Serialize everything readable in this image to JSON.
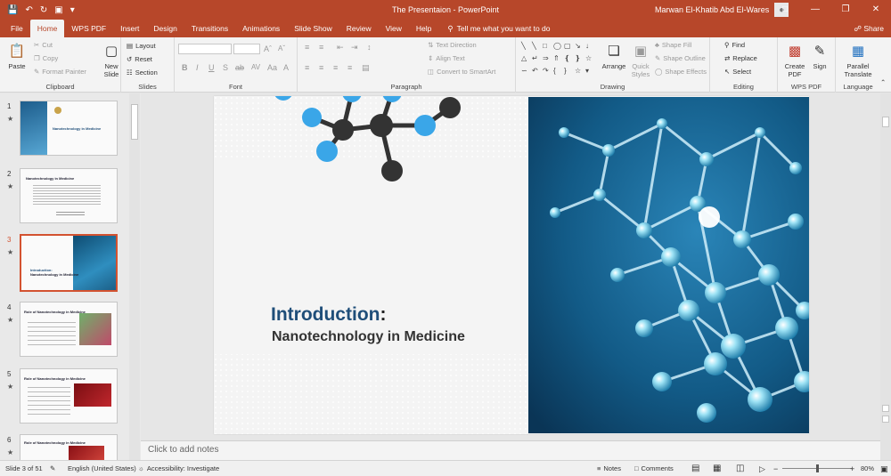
{
  "window": {
    "title": "The Presentaion  -  PowerPoint",
    "user": "Marwan El-Khatib Abd El-Wares"
  },
  "tabs": [
    {
      "label": "File"
    },
    {
      "label": "Home"
    },
    {
      "label": "WPS PDF"
    },
    {
      "label": "Insert"
    },
    {
      "label": "Design"
    },
    {
      "label": "Transitions"
    },
    {
      "label": "Animations"
    },
    {
      "label": "Slide Show"
    },
    {
      "label": "Review"
    },
    {
      "label": "View"
    },
    {
      "label": "Help"
    }
  ],
  "tellme": "Tell me what you want to do",
  "share": "Share",
  "ribbon": {
    "clipboard": {
      "label": "Clipboard",
      "paste": "Paste",
      "cut": "Cut",
      "copy": "Copy",
      "format_painter": "Format Painter"
    },
    "slides": {
      "label": "Slides",
      "new_slide": "New Slide",
      "layout": "Layout",
      "reset": "Reset",
      "section": "Section"
    },
    "font": {
      "label": "Font"
    },
    "paragraph": {
      "label": "Paragraph",
      "text_direction": "Text Direction",
      "align_text": "Align Text",
      "convert": "Convert to SmartArt"
    },
    "drawing": {
      "label": "Drawing",
      "arrange": "Arrange",
      "quick_styles": "Quick Styles",
      "shape_fill": "Shape Fill",
      "shape_outline": "Shape Outline",
      "shape_effects": "Shape Effects"
    },
    "editing": {
      "label": "Editing",
      "find": "Find",
      "replace": "Replace",
      "select": "Select"
    },
    "wps": {
      "label": "WPS PDF",
      "create_pdf": "Create PDF",
      "sign": "Sign"
    },
    "language": {
      "label": "Language",
      "parallel_translate": "Parallel Translate"
    }
  },
  "thumbnails": [
    {
      "num": "1",
      "title": "Nanotechnology in Medicine"
    },
    {
      "num": "2",
      "title": "Nanotechnology in Medicine"
    },
    {
      "num": "3",
      "title": "Introduction:",
      "sub": "Nanotechnology in Medicine"
    },
    {
      "num": "4",
      "title": "Role of Nanotechnology in Medicine"
    },
    {
      "num": "5",
      "title": "Role of Nanotechnology in Medicine"
    },
    {
      "num": "6",
      "title": "Role of Nanotechnology in Medicine"
    }
  ],
  "slide": {
    "heading": "Introduction",
    "colon": ":",
    "subtitle": "Nanotechnology in Medicine"
  },
  "notes_placeholder": "Click to add notes",
  "status": {
    "slide": "Slide 3 of 51",
    "language": "English (United States)",
    "accessibility": "Accessibility: Investigate",
    "notes": "Notes",
    "comments": "Comments",
    "zoom": "80%",
    "zoom_fraction": 0.5
  },
  "colors": {
    "accent": "#b7472a",
    "title_blue": "#1f4e79",
    "molecule_blue": "#3aa6e8",
    "molecule_dark": "#333333"
  }
}
